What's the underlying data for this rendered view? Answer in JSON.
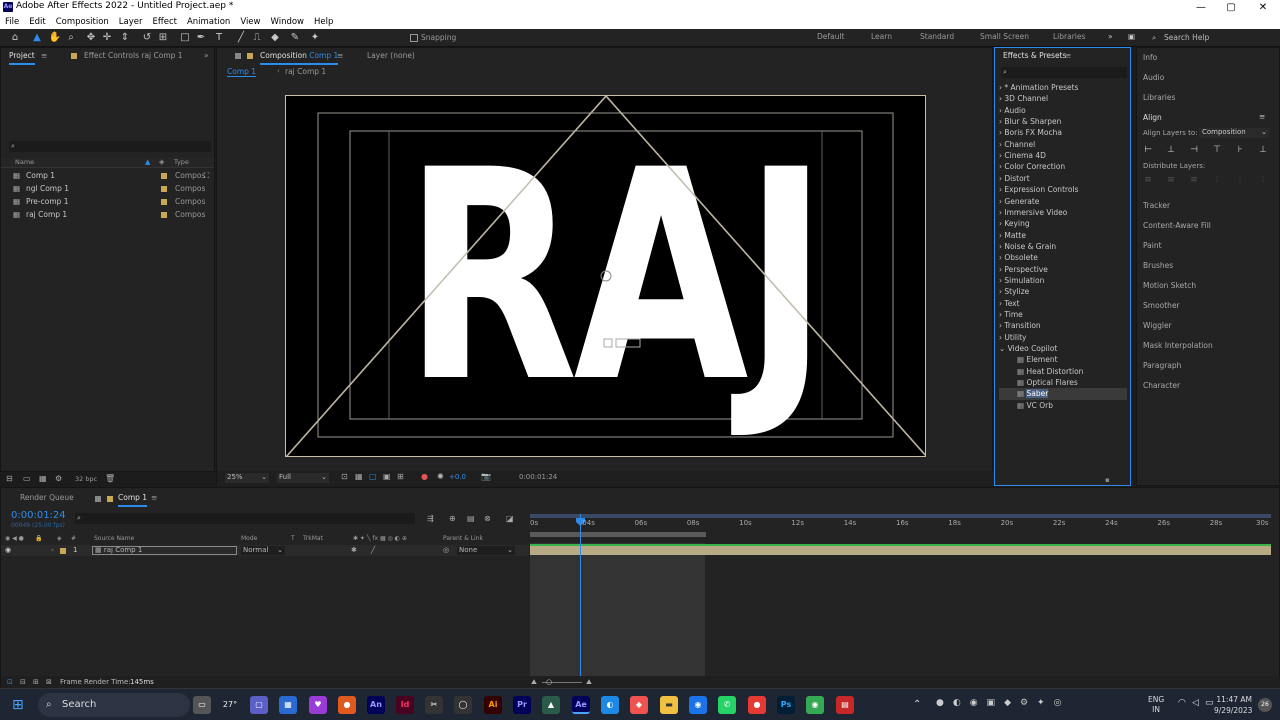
{
  "window": {
    "title": "Adobe After Effects 2022 - Untitled Project.aep *",
    "app_badge": "Ae",
    "minimize": "—",
    "maximize": "▢",
    "close": "✕"
  },
  "menu": [
    "File",
    "Edit",
    "Composition",
    "Layer",
    "Effect",
    "Animation",
    "View",
    "Window",
    "Help"
  ],
  "toolbar": {
    "snapping": "Snapping",
    "workspaces": [
      "Default",
      "Learn",
      "Standard",
      "Small Screen",
      "Libraries"
    ],
    "search_help": "Search Help"
  },
  "project": {
    "tab": "Project",
    "effect_controls_tab": "Effect Controls raj Comp 1",
    "col_name": "Name",
    "col_type": "Type",
    "items": [
      {
        "name": "Comp 1",
        "type": "Compos"
      },
      {
        "name": "ngl Comp 1",
        "type": "Compos"
      },
      {
        "name": "Pre-comp 1",
        "type": "Compos"
      },
      {
        "name": "raj Comp 1",
        "type": "Compos"
      }
    ],
    "bpc": "32 bpc"
  },
  "composition": {
    "tab_prefix": "Composition",
    "tab_name": "Comp 1",
    "layer_tab": "Layer (none)",
    "crumbs": [
      "Comp 1",
      "raj Comp 1"
    ],
    "text": "RAJ",
    "zoom": "25%",
    "resolution": "Full",
    "exposure": "+0.0",
    "timecode": "0:00:01:24"
  },
  "effects_presets": {
    "tab": "Effects & Presets",
    "categories": [
      "* Animation Presets",
      "3D Channel",
      "Audio",
      "Blur & Sharpen",
      "Boris FX Mocha",
      "Channel",
      "Cinema 4D",
      "Color Correction",
      "Distort",
      "Expression Controls",
      "Generate",
      "Immersive Video",
      "Keying",
      "Matte",
      "Noise & Grain",
      "Obsolete",
      "Perspective",
      "Simulation",
      "Stylize",
      "Text",
      "Time",
      "Transition",
      "Utility",
      "Video Copilot"
    ],
    "video_copilot_items": [
      "Element",
      "Heat Distortion",
      "Optical Flares",
      "Saber",
      "VC Orb"
    ],
    "selected": "Saber"
  },
  "right_panel": {
    "top_items": [
      "Info",
      "Audio",
      "Libraries"
    ],
    "align": {
      "title": "Align",
      "align_layers_to": "Align Layers to:",
      "target": "Composition",
      "distribute": "Distribute Layers:"
    },
    "bottom_items": [
      "Tracker",
      "Content-Aware Fill",
      "Paint",
      "Brushes",
      "Motion Sketch",
      "Smoother",
      "Wiggler",
      "Mask Interpolation",
      "Paragraph",
      "Character"
    ]
  },
  "timeline": {
    "render_queue_tab": "Render Queue",
    "comp_tab": "Comp 1",
    "timecode": "0:00:01:24",
    "frames": "00049 (25.00 fps)",
    "headers": {
      "num": "#",
      "source": "Source Name",
      "mode": "Mode",
      "t": "T",
      "trkmat": "TrkMat",
      "parent": "Parent & Link"
    },
    "layer": {
      "index": "1",
      "name": "raj Comp 1",
      "mode": "Normal",
      "parent": "None"
    },
    "ruler": [
      "0s",
      "04s",
      "06s",
      "08s",
      "10s",
      "12s",
      "14s",
      "16s",
      "18s",
      "20s",
      "22s",
      "24s",
      "26s",
      "28s",
      "30s"
    ],
    "frame_render_time_label": "Frame Render Time:",
    "frame_render_time": "145ms"
  },
  "taskbar": {
    "search": "Search",
    "weather": "27°",
    "apps": [
      "An",
      "Id",
      "Ai",
      "Pr",
      "Ae",
      "Ps"
    ],
    "lang": "ENG",
    "region": "IN",
    "time": "11:47 AM",
    "date": "9/29/2023"
  },
  "colors": {
    "accent": "#2d8ceb",
    "panel_bg": "#232323",
    "comp_label": "#c8a850",
    "track_green": "#3bb34a"
  }
}
